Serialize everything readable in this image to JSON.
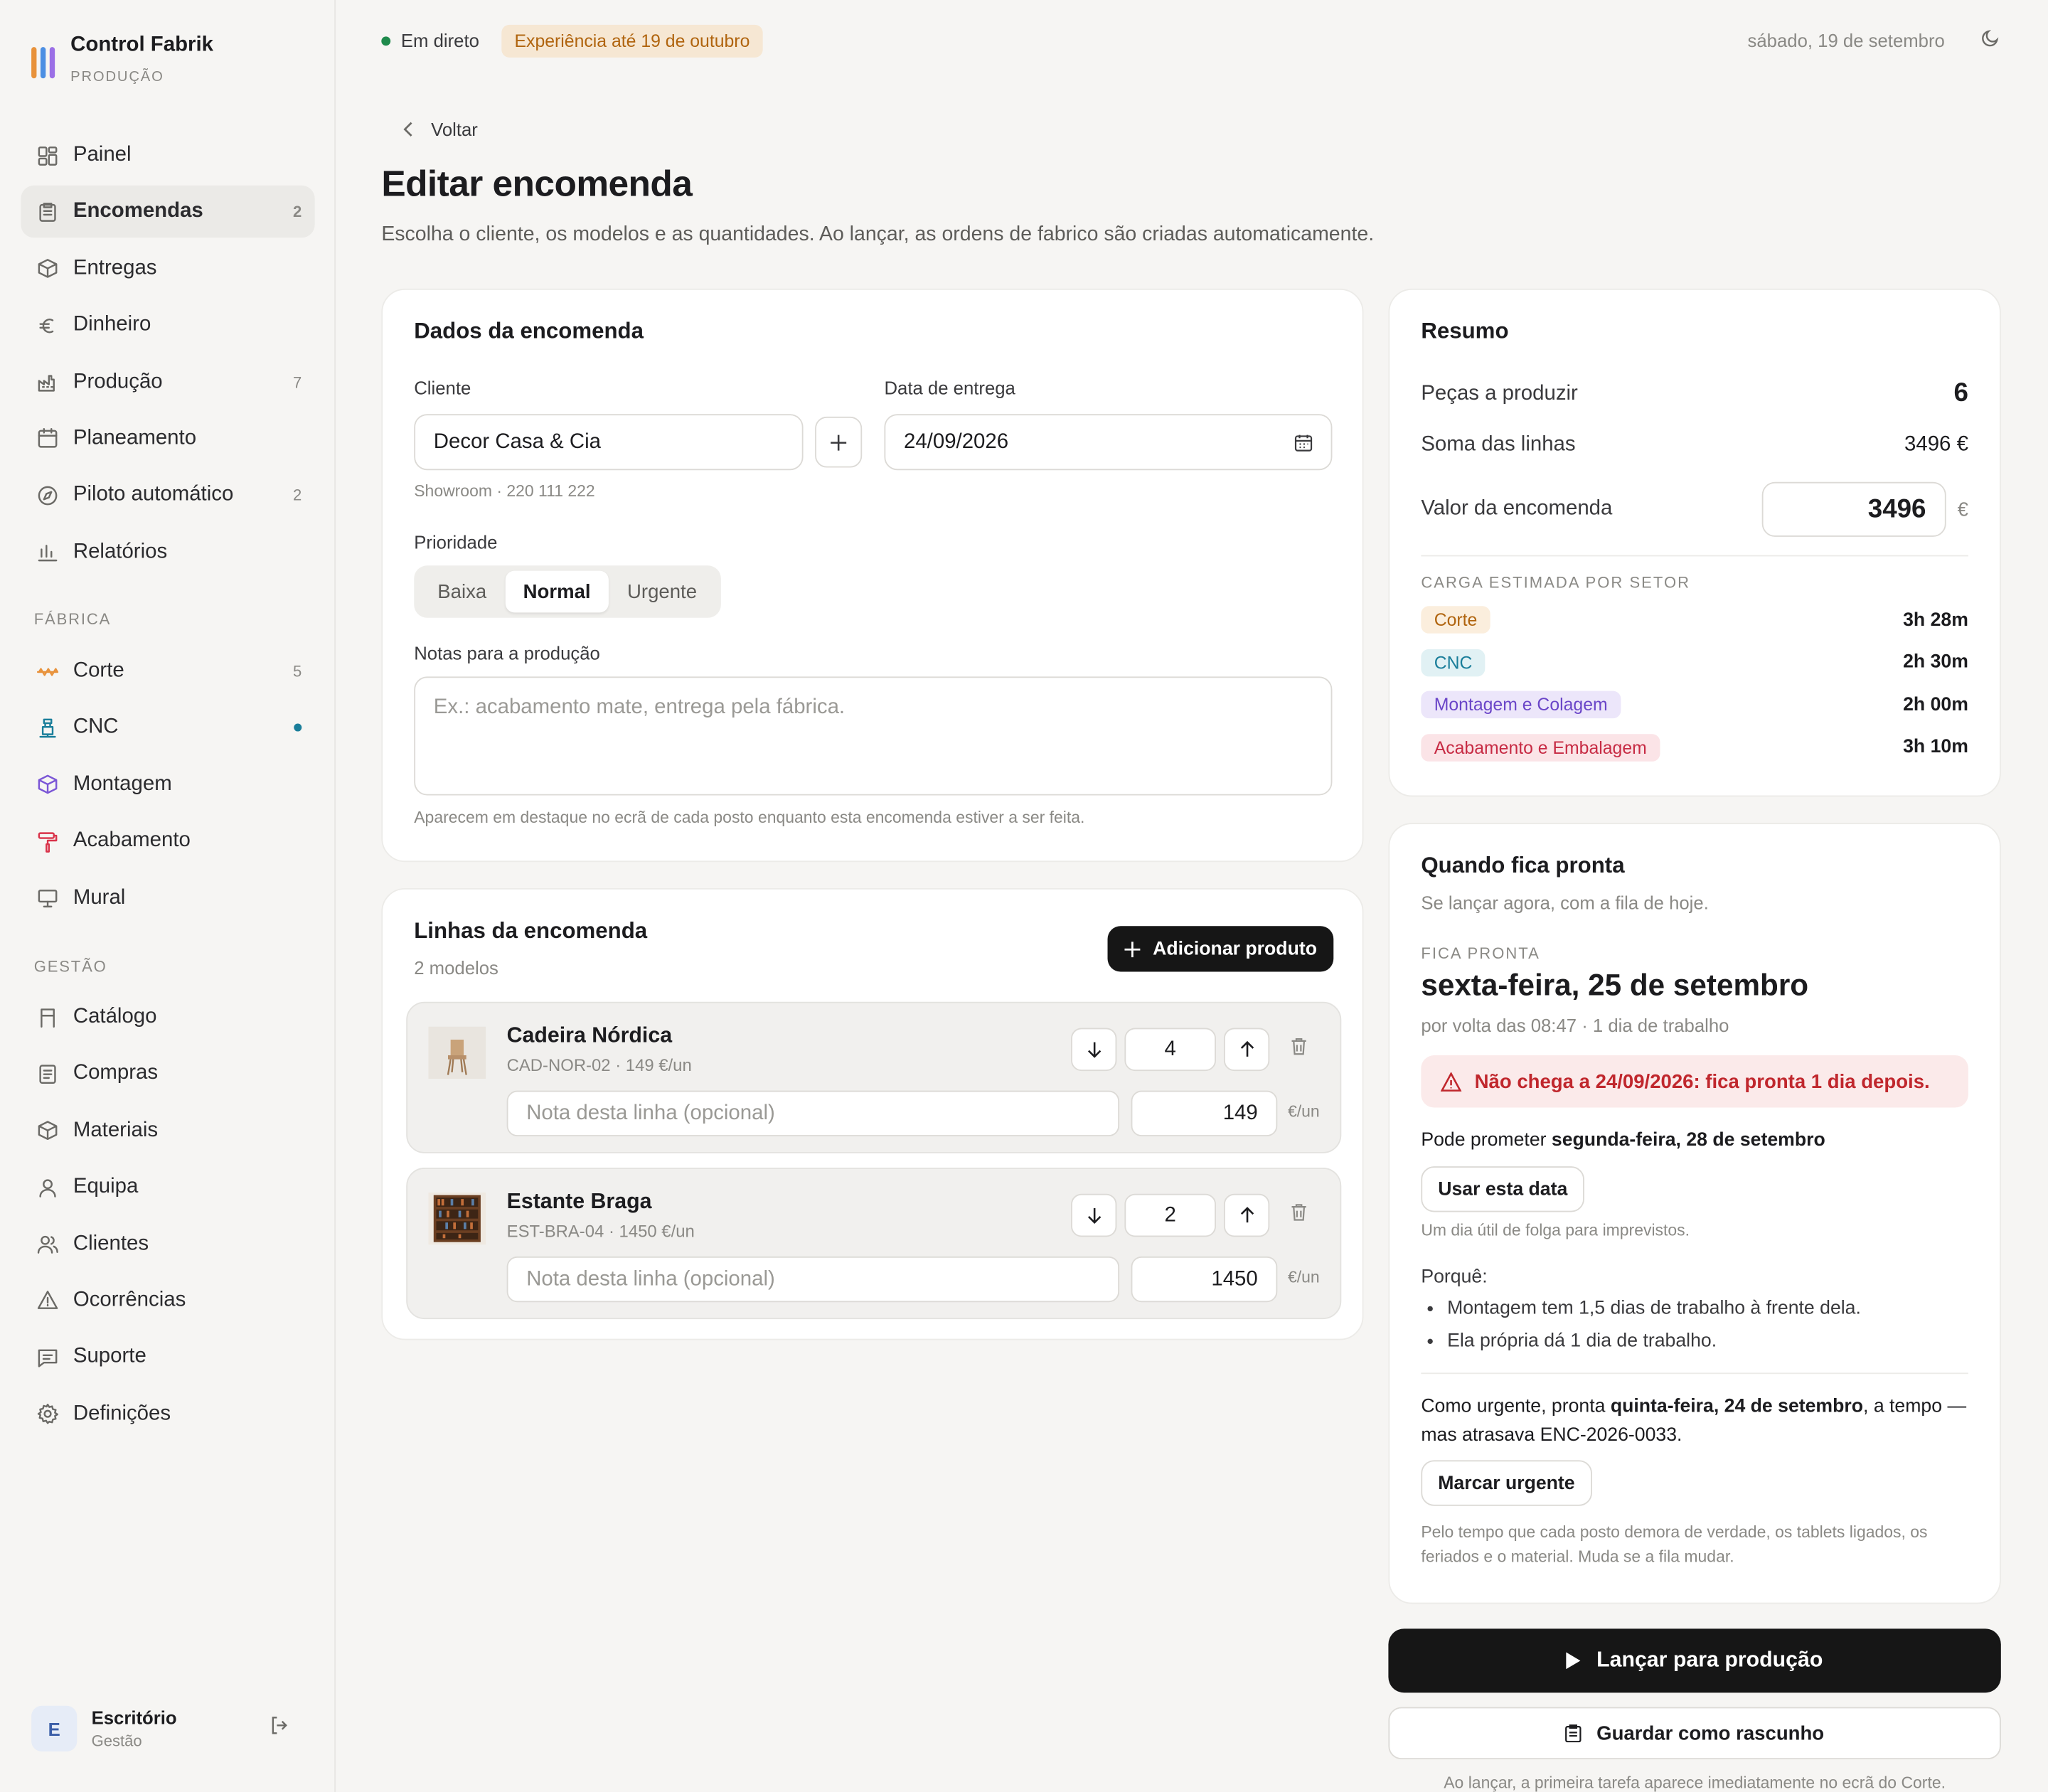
{
  "app": {
    "name": "Control Fabrik",
    "subtitle": "PRODUÇÃO",
    "logo_colors": [
      "#e8923b",
      "#4c8fe3",
      "#9b6fe6"
    ]
  },
  "sidebar": {
    "main": [
      {
        "label": "Painel",
        "icon": "dashboard-icon",
        "count": ""
      },
      {
        "label": "Encomendas",
        "icon": "clipboard-icon",
        "count": "2",
        "active": true
      },
      {
        "label": "Entregas",
        "icon": "box-icon",
        "count": ""
      },
      {
        "label": "Dinheiro",
        "icon": "euro-icon",
        "count": ""
      },
      {
        "label": "Produção",
        "icon": "factory-icon",
        "count": "7"
      },
      {
        "label": "Planeamento",
        "icon": "calendar-icon",
        "count": ""
      },
      {
        "label": "Piloto automático",
        "icon": "compass-icon",
        "count": "2"
      },
      {
        "label": "Relatórios",
        "icon": "bar-chart-icon",
        "count": ""
      }
    ],
    "factory_title": "FÁBRICA",
    "factory": [
      {
        "label": "Corte",
        "icon": "saw-icon",
        "count": "5",
        "color": "#e8923b"
      },
      {
        "label": "CNC",
        "icon": "cnc-icon",
        "count": "",
        "color": "#1a7e9a",
        "dot": true
      },
      {
        "label": "Montagem",
        "icon": "cube-icon",
        "count": "",
        "color": "#7b56d6"
      },
      {
        "label": "Acabamento",
        "icon": "paint-roller-icon",
        "count": "",
        "color": "#d9334a"
      },
      {
        "label": "Mural",
        "icon": "monitor-icon",
        "count": ""
      }
    ],
    "management_title": "GESTÃO",
    "management": [
      {
        "label": "Catálogo",
        "icon": "chair-icon"
      },
      {
        "label": "Compras",
        "icon": "receipt-icon"
      },
      {
        "label": "Materiais",
        "icon": "package-icon"
      },
      {
        "label": "Equipa",
        "icon": "user-icon"
      },
      {
        "label": "Clientes",
        "icon": "users-icon"
      },
      {
        "label": "Ocorrências",
        "icon": "alert-triangle-icon"
      },
      {
        "label": "Suporte",
        "icon": "message-icon"
      },
      {
        "label": "Definições",
        "icon": "gear-icon"
      }
    ],
    "user": {
      "initial": "E",
      "name": "Escritório",
      "role": "Gestão"
    }
  },
  "topbar": {
    "live": "Em direto",
    "trial": "Experiência até 19 de outubro",
    "date": "sábado, 19 de setembro"
  },
  "page": {
    "back": "Voltar",
    "title": "Editar encomenda",
    "subtitle": "Escolha o cliente, os modelos e as quantidades. Ao lançar, as ordens de fabrico são criadas automaticamente."
  },
  "order": {
    "title": "Dados da encomenda",
    "client_label": "Cliente",
    "client_value": "Decor Casa & Cia",
    "client_hint": "Showroom · 220 111 222",
    "date_label": "Data de entrega",
    "date_value": "24/09/2026",
    "priority_label": "Prioridade",
    "priorities": [
      "Baixa",
      "Normal",
      "Urgente"
    ],
    "priority_selected": "Normal",
    "notes_label": "Notas para a produção",
    "notes_placeholder": "Ex.: acabamento mate, entrega pela fábrica.",
    "notes_hint": "Aparecem em destaque no ecrã de cada posto enquanto esta encomenda estiver a ser feita."
  },
  "lines": {
    "title": "Linhas da encomenda",
    "count": "2 modelos",
    "add_button": "Adicionar produto",
    "note_placeholder": "Nota desta linha (opcional)",
    "unit": "€/un",
    "items": [
      {
        "name": "Cadeira Nórdica",
        "sub": "CAD-NOR-02 · 149 €/un",
        "qty": "4",
        "price": "149"
      },
      {
        "name": "Estante Braga",
        "sub": "EST-BRA-04 · 1450 €/un",
        "qty": "2",
        "price": "1450"
      }
    ]
  },
  "summary": {
    "title": "Resumo",
    "pieces_label": "Peças a produzir",
    "pieces_value": "6",
    "sum_label": "Soma das linhas",
    "sum_value": "3496 €",
    "order_value_label": "Valor da encomenda",
    "order_value": "3496",
    "currency": "€",
    "load_title": "CARGA ESTIMADA POR SETOR",
    "loads": [
      {
        "sector": "Corte",
        "time": "3h 28m",
        "bg": "#fbeedd",
        "fg": "#b0640e"
      },
      {
        "sector": "CNC",
        "time": "2h 30m",
        "bg": "#e1f1f4",
        "fg": "#1a7e9a"
      },
      {
        "sector": "Montagem e Colagem",
        "time": "2h 00m",
        "bg": "#ece6fa",
        "fg": "#6a45c8"
      },
      {
        "sector": "Acabamento e Embalagem",
        "time": "3h 10m",
        "bg": "#fbe4e7",
        "fg": "#c72b44"
      }
    ]
  },
  "ready": {
    "title": "Quando fica pronta",
    "subtitle": "Se lançar agora, com a fila de hoje.",
    "label": "FICA PRONTA",
    "date": "sexta-feira, 25 de setembro",
    "detail": "por volta das 08:47 · 1 dia de trabalho",
    "warning": "Não chega a 24/09/2026: fica pronta 1 dia depois.",
    "promise_prefix": "Pode prometer ",
    "promise_date": "segunda-feira, 28 de setembro",
    "use_date_button": "Usar esta data",
    "promise_hint": "Um dia útil de folga para imprevistos.",
    "why_label": "Porquê:",
    "reasons": [
      "Montagem tem 1,5 dias de trabalho à frente dela.",
      "Ela própria dá 1 dia de trabalho."
    ],
    "urgent_prefix": "Como urgente, pronta ",
    "urgent_date": "quinta-feira, 24 de setembro",
    "urgent_suffix": ", a tempo — mas atrasava ENC-2026-0033.",
    "urgent_button": "Marcar urgente",
    "footnote": "Pelo tempo que cada posto demora de verdade, os tablets ligados, os feriados e o material. Muda se a fila mudar."
  },
  "actions": {
    "launch": "Lançar para produção",
    "draft": "Guardar como rascunho",
    "footer": "Ao lançar, a primeira tarefa aparece imediatamente no ecrã do Corte."
  }
}
